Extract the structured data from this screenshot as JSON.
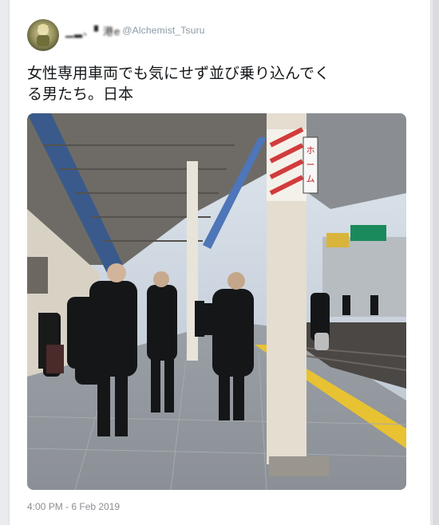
{
  "tweet": {
    "display_name": "▁▂、▘港e",
    "username": "@Alchemist_Tsuru",
    "text": "女性専用車両でも気にせず並び乗り込んでく\nる男たち。日本",
    "timestamp": "4:00 PM - 6 Feb 2019"
  },
  "photo": {
    "description_icon": "photo-icon",
    "sign_text": "ホ\nー\nム"
  },
  "colors": {
    "card_bg": "#ffffff",
    "page_bg": "#e9ebee",
    "text": "#14171a",
    "muted": "#8899a6",
    "platform_line": "#e8c232"
  }
}
